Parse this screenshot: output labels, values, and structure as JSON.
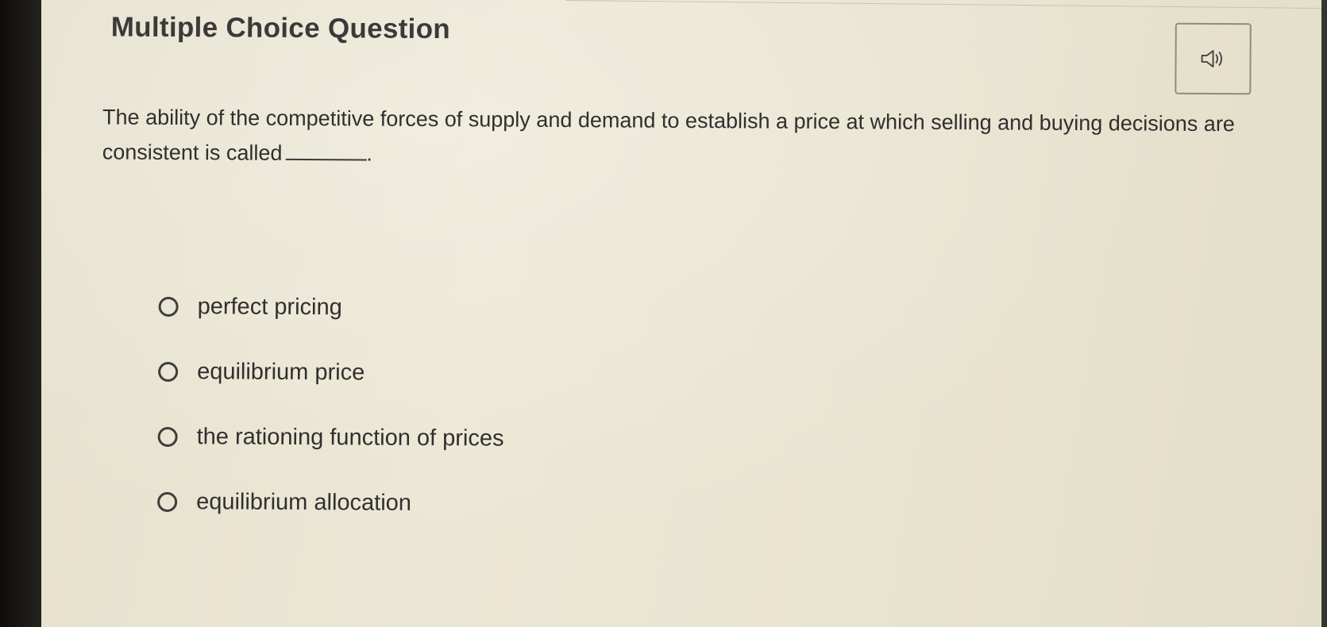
{
  "page": {
    "title": "Multiple Choice Question"
  },
  "audio_button": {
    "icon": "speaker-icon"
  },
  "question": {
    "text": "The ability of the competitive forces of supply and demand to establish a price at which selling and buying decisions are consistent is called",
    "terminal": "."
  },
  "options": [
    {
      "label": "perfect pricing",
      "selected": false
    },
    {
      "label": "equilibrium price",
      "selected": false
    },
    {
      "label": "the rationing function of prices",
      "selected": false
    },
    {
      "label": "equilibrium allocation",
      "selected": false
    }
  ],
  "colors": {
    "background": "#e9e4d0",
    "text": "#2f2f2f",
    "border": "#8f8b80"
  }
}
